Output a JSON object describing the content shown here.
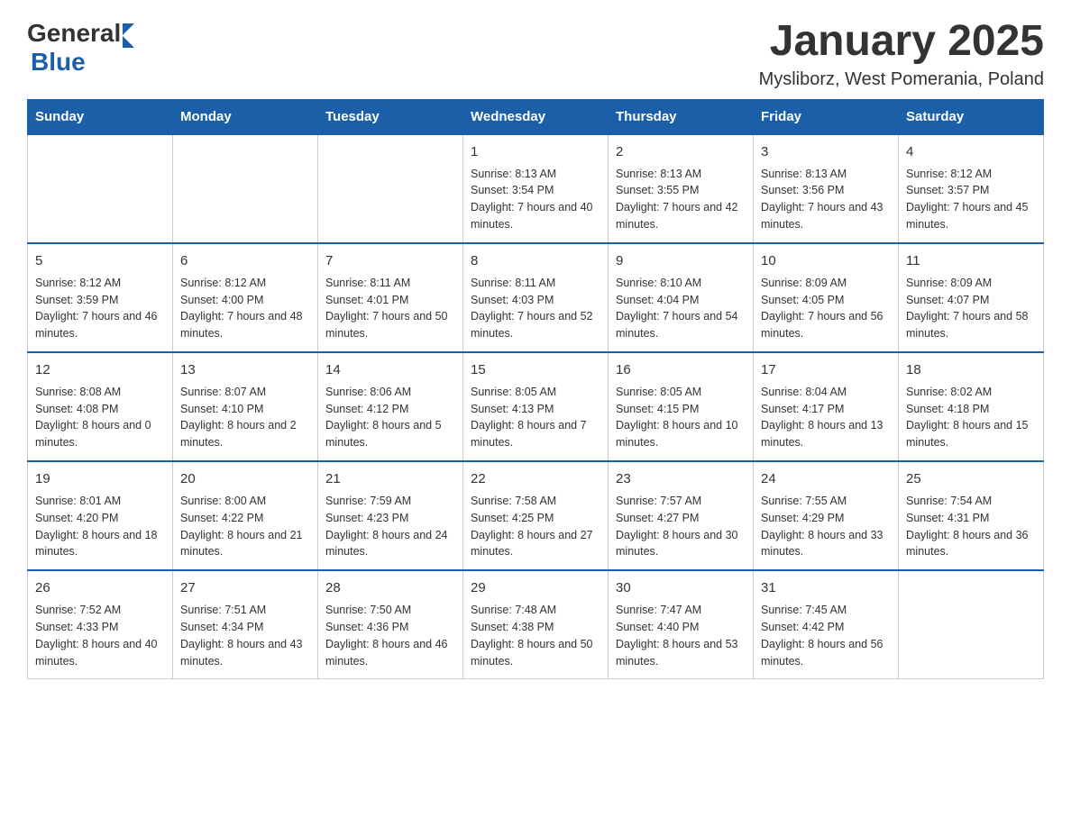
{
  "header": {
    "logo_general": "General",
    "logo_blue": "Blue",
    "month_title": "January 2025",
    "subtitle": "Mysliborz, West Pomerania, Poland"
  },
  "days_of_week": [
    "Sunday",
    "Monday",
    "Tuesday",
    "Wednesday",
    "Thursday",
    "Friday",
    "Saturday"
  ],
  "weeks": [
    [
      null,
      null,
      null,
      {
        "day": "1",
        "sunrise": "8:13 AM",
        "sunset": "3:54 PM",
        "daylight": "7 hours and 40 minutes."
      },
      {
        "day": "2",
        "sunrise": "8:13 AM",
        "sunset": "3:55 PM",
        "daylight": "7 hours and 42 minutes."
      },
      {
        "day": "3",
        "sunrise": "8:13 AM",
        "sunset": "3:56 PM",
        "daylight": "7 hours and 43 minutes."
      },
      {
        "day": "4",
        "sunrise": "8:12 AM",
        "sunset": "3:57 PM",
        "daylight": "7 hours and 45 minutes."
      }
    ],
    [
      {
        "day": "5",
        "sunrise": "8:12 AM",
        "sunset": "3:59 PM",
        "daylight": "7 hours and 46 minutes."
      },
      {
        "day": "6",
        "sunrise": "8:12 AM",
        "sunset": "4:00 PM",
        "daylight": "7 hours and 48 minutes."
      },
      {
        "day": "7",
        "sunrise": "8:11 AM",
        "sunset": "4:01 PM",
        "daylight": "7 hours and 50 minutes."
      },
      {
        "day": "8",
        "sunrise": "8:11 AM",
        "sunset": "4:03 PM",
        "daylight": "7 hours and 52 minutes."
      },
      {
        "day": "9",
        "sunrise": "8:10 AM",
        "sunset": "4:04 PM",
        "daylight": "7 hours and 54 minutes."
      },
      {
        "day": "10",
        "sunrise": "8:09 AM",
        "sunset": "4:05 PM",
        "daylight": "7 hours and 56 minutes."
      },
      {
        "day": "11",
        "sunrise": "8:09 AM",
        "sunset": "4:07 PM",
        "daylight": "7 hours and 58 minutes."
      }
    ],
    [
      {
        "day": "12",
        "sunrise": "8:08 AM",
        "sunset": "4:08 PM",
        "daylight": "8 hours and 0 minutes."
      },
      {
        "day": "13",
        "sunrise": "8:07 AM",
        "sunset": "4:10 PM",
        "daylight": "8 hours and 2 minutes."
      },
      {
        "day": "14",
        "sunrise": "8:06 AM",
        "sunset": "4:12 PM",
        "daylight": "8 hours and 5 minutes."
      },
      {
        "day": "15",
        "sunrise": "8:05 AM",
        "sunset": "4:13 PM",
        "daylight": "8 hours and 7 minutes."
      },
      {
        "day": "16",
        "sunrise": "8:05 AM",
        "sunset": "4:15 PM",
        "daylight": "8 hours and 10 minutes."
      },
      {
        "day": "17",
        "sunrise": "8:04 AM",
        "sunset": "4:17 PM",
        "daylight": "8 hours and 13 minutes."
      },
      {
        "day": "18",
        "sunrise": "8:02 AM",
        "sunset": "4:18 PM",
        "daylight": "8 hours and 15 minutes."
      }
    ],
    [
      {
        "day": "19",
        "sunrise": "8:01 AM",
        "sunset": "4:20 PM",
        "daylight": "8 hours and 18 minutes."
      },
      {
        "day": "20",
        "sunrise": "8:00 AM",
        "sunset": "4:22 PM",
        "daylight": "8 hours and 21 minutes."
      },
      {
        "day": "21",
        "sunrise": "7:59 AM",
        "sunset": "4:23 PM",
        "daylight": "8 hours and 24 minutes."
      },
      {
        "day": "22",
        "sunrise": "7:58 AM",
        "sunset": "4:25 PM",
        "daylight": "8 hours and 27 minutes."
      },
      {
        "day": "23",
        "sunrise": "7:57 AM",
        "sunset": "4:27 PM",
        "daylight": "8 hours and 30 minutes."
      },
      {
        "day": "24",
        "sunrise": "7:55 AM",
        "sunset": "4:29 PM",
        "daylight": "8 hours and 33 minutes."
      },
      {
        "day": "25",
        "sunrise": "7:54 AM",
        "sunset": "4:31 PM",
        "daylight": "8 hours and 36 minutes."
      }
    ],
    [
      {
        "day": "26",
        "sunrise": "7:52 AM",
        "sunset": "4:33 PM",
        "daylight": "8 hours and 40 minutes."
      },
      {
        "day": "27",
        "sunrise": "7:51 AM",
        "sunset": "4:34 PM",
        "daylight": "8 hours and 43 minutes."
      },
      {
        "day": "28",
        "sunrise": "7:50 AM",
        "sunset": "4:36 PM",
        "daylight": "8 hours and 46 minutes."
      },
      {
        "day": "29",
        "sunrise": "7:48 AM",
        "sunset": "4:38 PM",
        "daylight": "8 hours and 50 minutes."
      },
      {
        "day": "30",
        "sunrise": "7:47 AM",
        "sunset": "4:40 PM",
        "daylight": "8 hours and 53 minutes."
      },
      {
        "day": "31",
        "sunrise": "7:45 AM",
        "sunset": "4:42 PM",
        "daylight": "8 hours and 56 minutes."
      },
      null
    ]
  ],
  "labels": {
    "sunrise_prefix": "Sunrise: ",
    "sunset_prefix": "Sunset: ",
    "daylight_prefix": "Daylight: "
  }
}
